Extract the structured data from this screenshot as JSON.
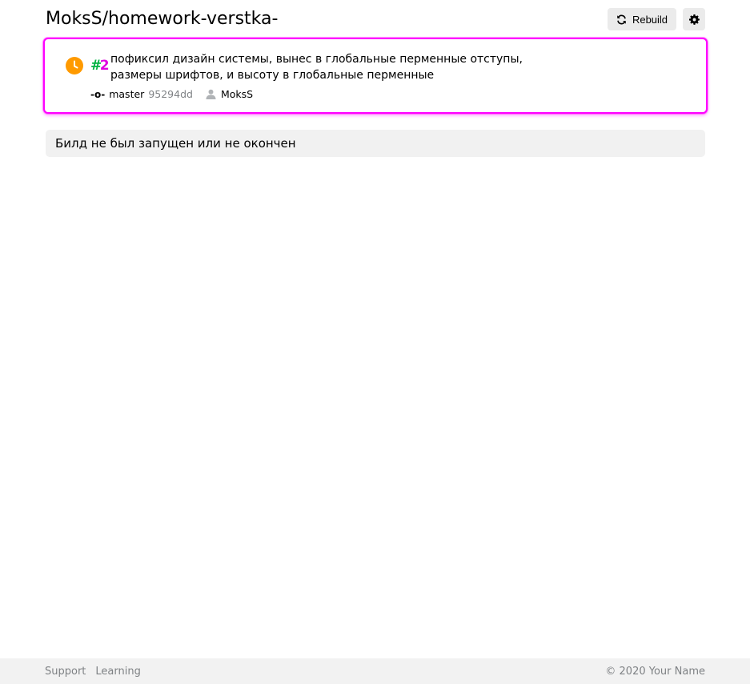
{
  "header": {
    "repo_title": "MoksS/homework-verstka-",
    "rebuild_label": "Rebuild"
  },
  "build": {
    "status": "pending",
    "status_color": "#ff9a00",
    "number_hash": "#",
    "number": "2",
    "message": "пофиксил дизайн системы, вынес в глобальные перменные отступы, размеры шрифтов, и высоту в глобальные перменные",
    "branch_icon": "-o-",
    "branch": "master",
    "commit_hash": "95294dd",
    "author": "MoksS"
  },
  "notice": {
    "text": "Билд не был запущен или не окончен"
  },
  "footer": {
    "links": [
      "Support",
      "Learning"
    ],
    "copyright": "© 2020 Your Name"
  },
  "colors": {
    "highlight_border": "#ff00ff",
    "success_green": "#00b341",
    "muted_text": "#7f8285",
    "button_bg": "#ebebeb"
  }
}
